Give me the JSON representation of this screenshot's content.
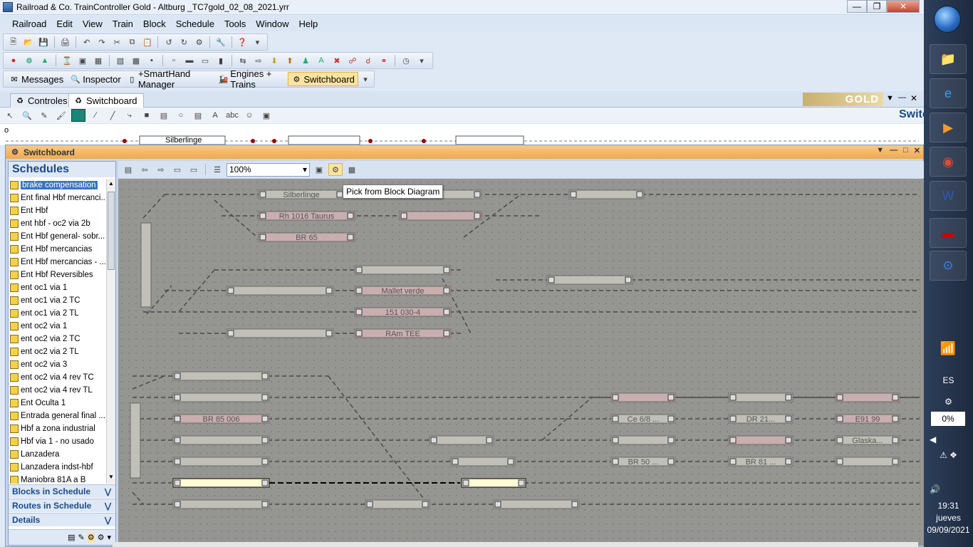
{
  "window": {
    "title": "Railroad & Co. TrainController Gold - Altburg _TC7gold_02_08_2021.yrr"
  },
  "menu": [
    "Railroad",
    "Edit",
    "View",
    "Train",
    "Block",
    "Schedule",
    "Tools",
    "Window",
    "Help"
  ],
  "toolbar3": {
    "messages": "Messages",
    "inspector": "Inspector",
    "smarthand": "+SmartHand Manager",
    "engines": "Engines + Trains",
    "switchboard": "Switchboard"
  },
  "doc_tabs": [
    {
      "label": "Controles"
    },
    {
      "label": "Switchboard"
    }
  ],
  "gold_logo": "GOLD",
  "switchboard_heading": "Switchboard",
  "strip": {
    "o_label": "o",
    "blocks": [
      "Silberlinge"
    ]
  },
  "sb_window_title": "Switchboard",
  "schedules": {
    "title": "Schedules",
    "items": [
      "brake compensation",
      "Ent final Hbf mercanci...",
      "Ent Hbf",
      "ent hbf - oc2 via 2b",
      "Ent Hbf general- sobr...",
      "Ent Hbf mercancias",
      "Ent Hbf mercancias - ...",
      "Ent Hbf Reversibles",
      "ent oc1 via 1",
      "ent oc1 via 2 TC",
      "ent oc1 via 2 TL",
      "ent oc2 via 1",
      "ent oc2 via 2 TC",
      "ent oc2 via 2 TL",
      "ent oc2 via 3",
      "ent oc2 via 4 rev TC",
      "ent oc2 via 4 rev TL",
      "Ent Oculta 1",
      "Entrada general final ...",
      "Hbf a zona industrial",
      "Hbf via 1 - no usado",
      "Lanzadera",
      "Lanzadera indst-hbf",
      "Maniobra 81A a B"
    ]
  },
  "accordion": {
    "blocks": "Blocks in Schedule",
    "routes": "Routes in Schedule",
    "details": "Details"
  },
  "zoom": "100%",
  "tooltip": "Pick from Block Diagram",
  "blocks": [
    "Silberlinge",
    "Rh 1016 Taurus",
    "BR 65",
    "Mallet verde",
    "151 030-4",
    "RAm TEE",
    "BR 85 006",
    "Ce 6/8 ...",
    "DR 21...",
    "E91 99",
    "Glaska...",
    "BR 50 ...",
    "BR 81 ..."
  ],
  "tray": {
    "lang": "ES",
    "battery": "0%",
    "time": "19:31",
    "day": "jueves",
    "date": "09/09/2021"
  },
  "taskbar_apps": [
    "folder",
    "internet-explorer",
    "media-player",
    "chrome",
    "word",
    "marklin",
    "train-controller"
  ],
  "colors": {
    "accent": "#3b72c4",
    "window_header": "#eeaa4f",
    "diagram_bg": "#959592",
    "block_fill": "#c0c0b8",
    "block_occupied": "#c9aeb0",
    "block_active": "#fffbd6"
  }
}
